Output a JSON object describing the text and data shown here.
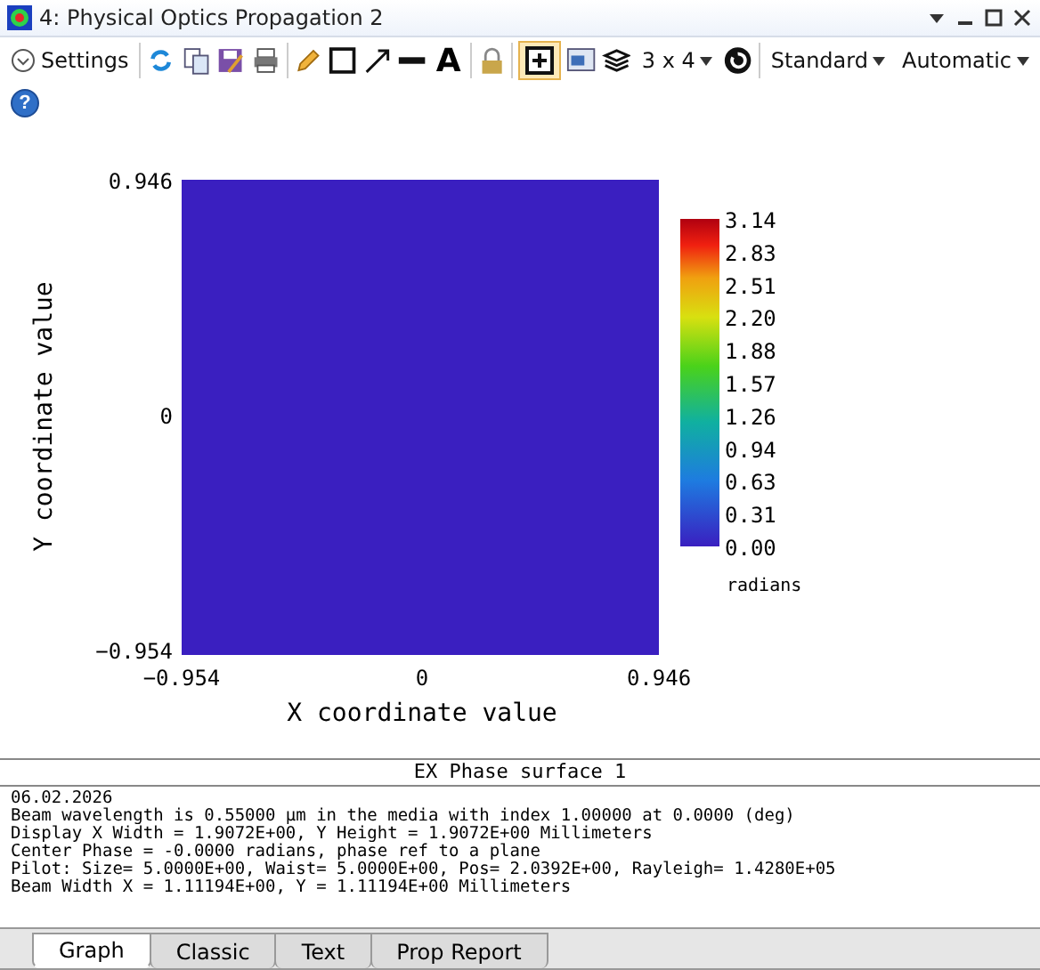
{
  "window": {
    "title": "4: Physical Optics Propagation 2"
  },
  "toolbar": {
    "settings_label": "Settings",
    "text_tool": "A",
    "layout": "3 x 4",
    "style": "Standard",
    "scale": "Automatic",
    "help": "?",
    "frame_selected": true
  },
  "plot": {
    "y_ticks": [
      "0.946",
      "0",
      "−0.954"
    ],
    "x_ticks": [
      "−0.954",
      "0",
      "0.946"
    ],
    "xlabel": "X coordinate value",
    "ylabel": "Y coordinate value",
    "colorbar": {
      "ticks": [
        "3.14",
        "2.83",
        "2.51",
        "2.20",
        "1.88",
        "1.57",
        "1.26",
        "0.94",
        "0.63",
        "0.31",
        "0.00"
      ],
      "unit": "radians"
    }
  },
  "report": {
    "title": "EX Phase surface 1",
    "lines": [
      "06.02.2026",
      "Beam wavelength is 0.55000 µm in the media with index 1.00000 at 0.0000 (deg)",
      "Display X Width = 1.9072E+00, Y Height = 1.9072E+00 Millimeters",
      "Center Phase = -0.0000 radians, phase ref to a plane",
      "Pilot: Size= 5.0000E+00, Waist= 5.0000E+00, Pos= 2.0392E+00, Rayleigh= 1.4280E+05",
      "Beam Width X = 1.11194E+00, Y = 1.11194E+00 Millimeters"
    ]
  },
  "tabs": [
    {
      "label": "Graph",
      "selected": true
    },
    {
      "label": "Classic",
      "selected": false
    },
    {
      "label": "Text",
      "selected": false
    },
    {
      "label": "Prop Report",
      "selected": false
    }
  ]
}
